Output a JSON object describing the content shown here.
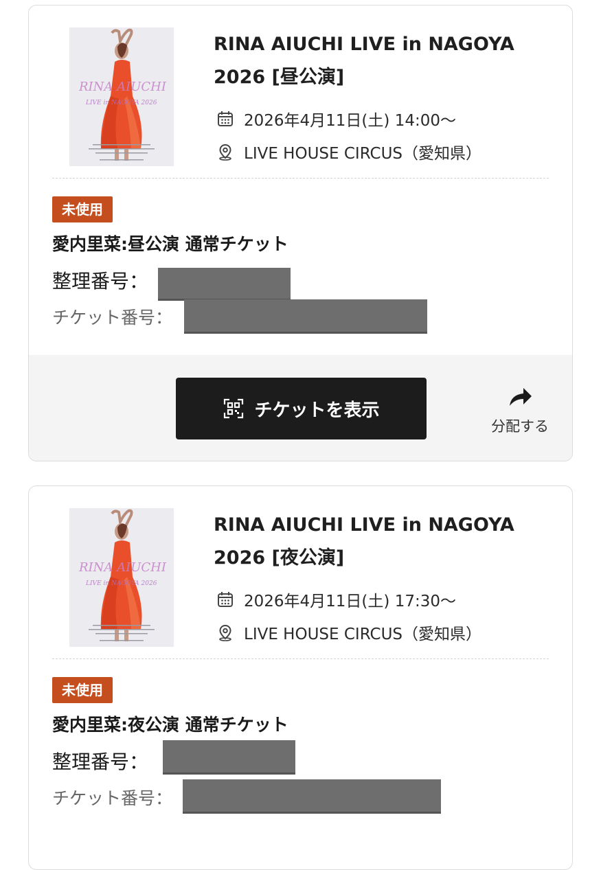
{
  "tickets": [
    {
      "poster_text": "RINA AIUCHI",
      "poster_subtext": "LIVE in NAGOYA 2026",
      "title": "RINA AIUCHI LIVE in NAGOYA 2026 [昼公演]",
      "date": "2026年4月11日(土) 14:00～",
      "venue": "LIVE HOUSE CIRCUS（愛知県）",
      "status": "未使用",
      "ticket_name": "愛内里菜:昼公演 通常チケット",
      "seat_label": "整理番号：",
      "ticket_no_label": "チケット番号：",
      "show_button": "チケットを表示",
      "share_label": "分配する"
    },
    {
      "poster_text": "RINA AIUCHI",
      "poster_subtext": "LIVE in NAGOYA 2026",
      "title": "RINA AIUCHI LIVE in NAGOYA 2026 [夜公演]",
      "date": "2026年4月11日(土) 17:30～",
      "venue": "LIVE HOUSE CIRCUS（愛知県）",
      "status": "未使用",
      "ticket_name": "愛内里菜:夜公演 通常チケット",
      "seat_label": "整理番号：",
      "ticket_no_label": "チケット番号："
    }
  ],
  "colors": {
    "badge": "#c54e1e",
    "button": "#1c1c1c",
    "redaction": "#6e6e6e"
  },
  "icons": {
    "date": "calendar-icon",
    "venue": "location-pin-icon",
    "show": "qr-code-icon",
    "share": "share-arrow-icon"
  }
}
